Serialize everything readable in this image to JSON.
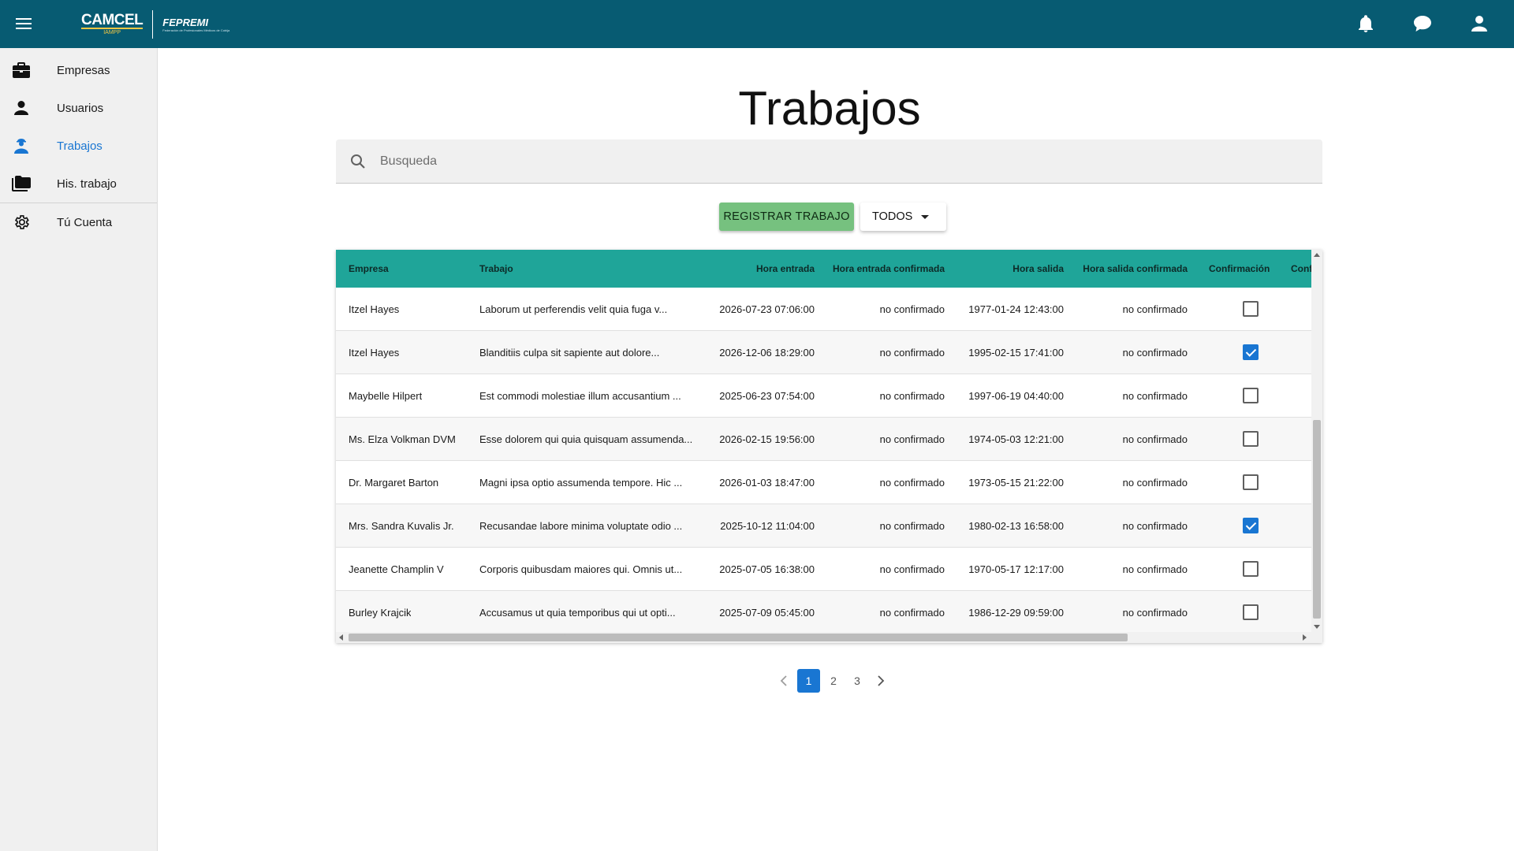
{
  "header": {
    "brand_primary": "CAMCEL",
    "brand_primary_sub": "IAMPP",
    "brand_secondary": "FEPREMI",
    "brand_secondary_sub": "Federación de Profesionales Médicos de Cobija",
    "icons": [
      "menu-icon",
      "bell-icon",
      "chat-icon",
      "account-icon"
    ]
  },
  "sidebar": {
    "items": [
      {
        "label": "Empresas",
        "icon": "briefcase-icon",
        "active": false
      },
      {
        "label": "Usuarios",
        "icon": "person-icon",
        "active": false
      },
      {
        "label": "Trabajos",
        "icon": "worker-icon",
        "active": true
      },
      {
        "label": "His. trabajo",
        "icon": "folder-icon",
        "active": false
      },
      {
        "label": "Tú Cuenta",
        "icon": "gear-icon",
        "active": false
      }
    ]
  },
  "main": {
    "title": "Trabajos",
    "search_placeholder": "Busqueda",
    "register_button": "REGISTRAR TRABAJO",
    "filter_button": "TODOS"
  },
  "table": {
    "columns": [
      "Empresa",
      "Trabajo",
      "Hora entrada",
      "Hora entrada confirmada",
      "Hora salida",
      "Hora salida confirmada",
      "Confirmación",
      "Conf"
    ],
    "rows": [
      {
        "empresa": "Itzel Hayes",
        "trabajo": "Laborum ut perferendis velit quia fuga v...",
        "hora_entrada": "2026-07-23 07:06:00",
        "entrada_confirmada": "no confirmado",
        "hora_salida": "1977-01-24 12:43:00",
        "salida_confirmada": "no confirmado",
        "confirmacion": false
      },
      {
        "empresa": "Itzel Hayes",
        "trabajo": "Blanditiis culpa sit sapiente aut dolore...",
        "hora_entrada": "2026-12-06 18:29:00",
        "entrada_confirmada": "no confirmado",
        "hora_salida": "1995-02-15 17:41:00",
        "salida_confirmada": "no confirmado",
        "confirmacion": true
      },
      {
        "empresa": "Maybelle Hilpert",
        "trabajo": "Est commodi molestiae illum accusantium ...",
        "hora_entrada": "2025-06-23 07:54:00",
        "entrada_confirmada": "no confirmado",
        "hora_salida": "1997-06-19 04:40:00",
        "salida_confirmada": "no confirmado",
        "confirmacion": false
      },
      {
        "empresa": "Ms. Elza Volkman DVM",
        "trabajo": "Esse dolorem qui quia quisquam assumenda...",
        "hora_entrada": "2026-02-15 19:56:00",
        "entrada_confirmada": "no confirmado",
        "hora_salida": "1974-05-03 12:21:00",
        "salida_confirmada": "no confirmado",
        "confirmacion": false
      },
      {
        "empresa": "Dr. Margaret Barton",
        "trabajo": "Magni ipsa optio assumenda tempore. Hic ...",
        "hora_entrada": "2026-01-03 18:47:00",
        "entrada_confirmada": "no confirmado",
        "hora_salida": "1973-05-15 21:22:00",
        "salida_confirmada": "no confirmado",
        "confirmacion": false
      },
      {
        "empresa": "Mrs. Sandra Kuvalis Jr.",
        "trabajo": "Recusandae labore minima voluptate odio ...",
        "hora_entrada": "2025-10-12 11:04:00",
        "entrada_confirmada": "no confirmado",
        "hora_salida": "1980-02-13 16:58:00",
        "salida_confirmada": "no confirmado",
        "confirmacion": true
      },
      {
        "empresa": "Jeanette Champlin V",
        "trabajo": "Corporis quibusdam maiores qui. Omnis ut...",
        "hora_entrada": "2025-07-05 16:38:00",
        "entrada_confirmada": "no confirmado",
        "hora_salida": "1970-05-17 12:17:00",
        "salida_confirmada": "no confirmado",
        "confirmacion": false
      },
      {
        "empresa": "Burley Krajcik",
        "trabajo": "Accusamus ut quia temporibus qui ut opti...",
        "hora_entrada": "2025-07-09 05:45:00",
        "entrada_confirmada": "no confirmado",
        "hora_salida": "1986-12-29 09:59:00",
        "salida_confirmada": "no confirmado",
        "confirmacion": false
      }
    ]
  },
  "pagination": {
    "pages": [
      "1",
      "2",
      "3"
    ],
    "current": "1"
  },
  "colors": {
    "topbar": "#075b72",
    "table_header": "#1fa599",
    "register_button": "#76c17f",
    "accent": "#1976d2"
  }
}
